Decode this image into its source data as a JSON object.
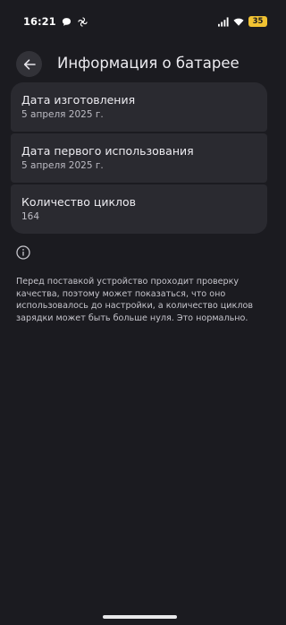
{
  "status_bar": {
    "time": "16:21",
    "battery_level": "35",
    "icons": [
      "chat-bubble-icon",
      "fan-icon",
      "cellular-signal-icon",
      "wifi-icon",
      "battery-icon"
    ]
  },
  "header": {
    "back_icon": "arrow-left-icon",
    "title": "Информация о батарее"
  },
  "cards": [
    {
      "title": "Дата изготовления",
      "value": "5 апреля 2025 г."
    },
    {
      "title": "Дата первого использования",
      "value": "5 апреля 2025 г."
    },
    {
      "title": "Количество циклов",
      "value": "164"
    }
  ],
  "note": {
    "icon": "info-icon",
    "text": "Перед поставкой устройство проходит проверку качества, поэтому может показаться, что оно использовалось до настройки, а количество циклов зарядки может быть больше нуля. Это нормально."
  },
  "colors": {
    "background": "#1b1b20",
    "card": "#2a2a30",
    "battery_badge": "#f1c232"
  }
}
